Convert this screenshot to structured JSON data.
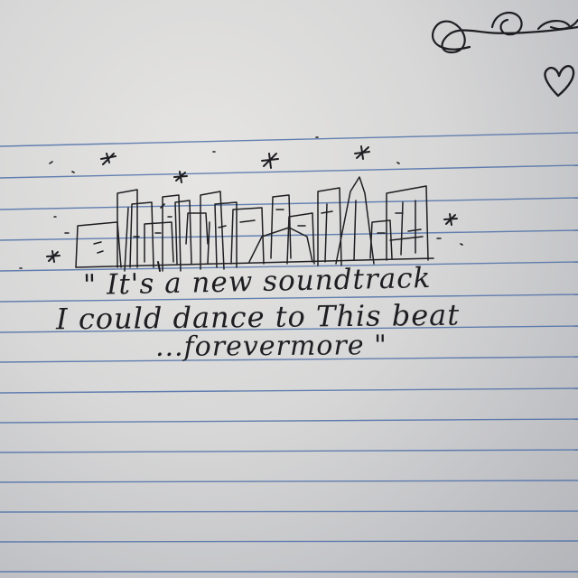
{
  "image": {
    "subject": "notebook",
    "lyrics": [
      "\" It's a new soundtrack",
      "I could dance to This beat",
      "...forevermore \""
    ],
    "colors": {
      "paper": "#d9d9d9",
      "rule_line": "#4d6fa8",
      "ink": "#1e1e22"
    },
    "icons": [
      "heart-icon",
      "star-icon",
      "swirl-icon"
    ]
  }
}
